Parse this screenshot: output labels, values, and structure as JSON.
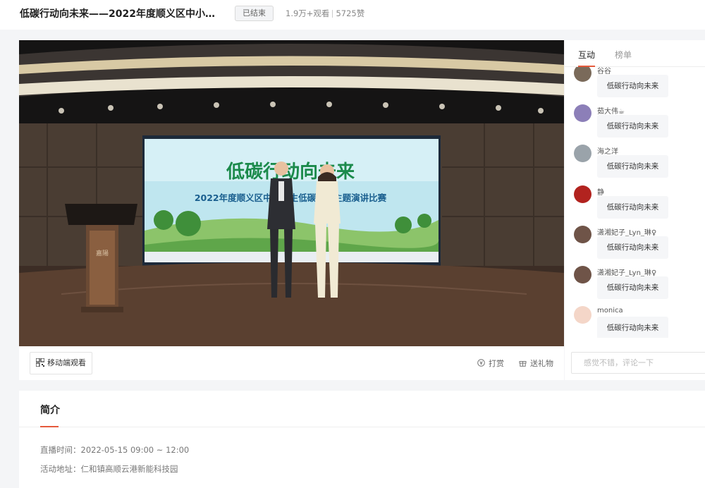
{
  "header": {
    "title": "低碳行动向未来——2022年度顺义区中小学生...",
    "status": "已结束",
    "views": "1.9万+观看",
    "likes": "5725赞"
  },
  "player": {
    "mobile_label": "移动端观看",
    "tip_label": "打赏",
    "gift_label": "送礼物",
    "screen": {
      "big_title": "低碳行动向未来",
      "subtitle": "2022年度顺义区中小学生低碳环保主题演讲比赛",
      "podium_text": "嘉陽"
    }
  },
  "sidebar": {
    "tabs": [
      {
        "label": "互动",
        "active": true
      },
      {
        "label": "榜单",
        "active": false
      }
    ],
    "messages": [
      {
        "user": "谷谷",
        "text": "低碳行动向未来",
        "avatar_color": "#7a6a5a"
      },
      {
        "user": "茹大伟☕",
        "text": "低碳行动向未来",
        "avatar_color": "#8c7fb8"
      },
      {
        "user": "海之洋",
        "text": "低碳行动向未来",
        "avatar_color": "#9aa3aa"
      },
      {
        "user": "静",
        "text": "低碳行动向未来",
        "avatar_color": "#b2231f"
      },
      {
        "user": "潇湘妃子_Lyn_琳♀",
        "text": "低碳行动向未来",
        "avatar_color": "#6f5448"
      },
      {
        "user": "潇湘妃子_Lyn_琳♀",
        "text": "低碳行动向未来",
        "avatar_color": "#6f5448"
      },
      {
        "user": "monica",
        "text": "低碳行动向未来",
        "avatar_color": "#f4d6c8"
      }
    ],
    "comment_placeholder": "感觉不错，评论一下"
  },
  "intro": {
    "title": "简介",
    "time_label": "直播时间：2022-05-15 09:00 ~ 12:00",
    "address_label": "活动地址：仁和镇高顺云港新能科技园"
  },
  "colors": {
    "accent": "#e55a3c",
    "background": "#f4f5f7"
  }
}
